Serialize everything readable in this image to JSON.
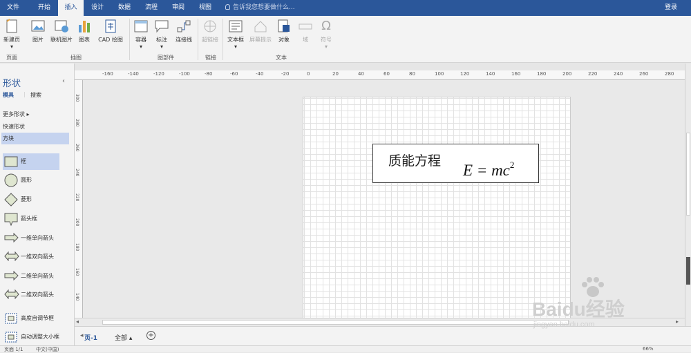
{
  "tabs": [
    "文件",
    "开始",
    "插入",
    "设计",
    "数据",
    "流程",
    "审阅",
    "视图"
  ],
  "active_tab": "插入",
  "tellme_placeholder": "告诉我您想要做什么...",
  "login": "登录",
  "ribbon": {
    "new_page": "新建页",
    "picture": "图片",
    "online_picture": "联机图片",
    "chart": "图表",
    "cad": "CAD 绘图",
    "container": "容器",
    "callout": "标注",
    "connector": "连接线",
    "hyperlink": "超链接",
    "textbox": "文本框",
    "screentip": "屏幕提示",
    "object": "对象",
    "field": "域",
    "symbol": "符号",
    "groups": {
      "pages": "页面",
      "illustrations": "插图",
      "diagram_parts": "图部件",
      "links": "链接",
      "text": "文本"
    }
  },
  "panel": {
    "title": "形状",
    "tab_stencils": "模具",
    "tab_search": "搜索",
    "more_shapes": "更多形状",
    "quick_shapes": "快速形状",
    "blocks": "方块",
    "shapes": [
      "框",
      "圆形",
      "菱形",
      "箭头框",
      "一维单向箭头",
      "一维双向箭头",
      "二维单向箭头",
      "二维双向箭头",
      "高度自调节框",
      "自动调整大小框"
    ]
  },
  "hruler_ticks": [
    "-160",
    "-140",
    "-120",
    "-100",
    "-80",
    "-60",
    "-40",
    "-20",
    "0",
    "20",
    "40",
    "60",
    "80",
    "100",
    "120",
    "140",
    "160",
    "180",
    "200",
    "220",
    "240",
    "260",
    "280"
  ],
  "vruler_ticks": [
    "300",
    "280",
    "260",
    "240",
    "220",
    "200",
    "180",
    "160",
    "140"
  ],
  "equation": {
    "title": "质能方程",
    "formula": "E = mc",
    "exponent": "2"
  },
  "pagebar": {
    "page_tab": "页-1",
    "all_pages": "全部"
  },
  "status": {
    "page_info": "页面 1/1",
    "language": "中文(中国)",
    "zoom": "66%"
  },
  "watermark": {
    "brand": "Baidu经验",
    "url": "jingyan.baidu.com"
  },
  "colors": {
    "accent": "#2b579a",
    "selected": "#c5d3ef"
  }
}
